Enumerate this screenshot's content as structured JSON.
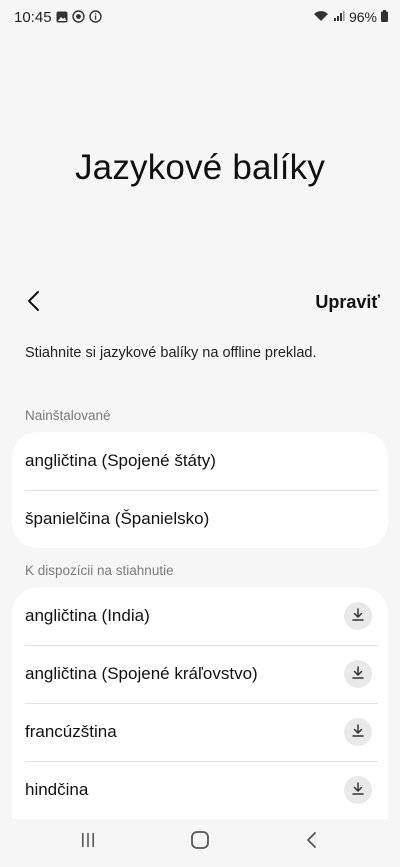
{
  "status_bar": {
    "time": "10:45",
    "battery": "96%",
    "left_icons": [
      "gallery-icon",
      "sync-icon",
      "info-icon"
    ],
    "right_icons": [
      "wifi-icon",
      "signal-icon",
      "battery-icon"
    ]
  },
  "header": {
    "title": "Jazykové balíky",
    "edit_label": "Upraviť",
    "back_icon": "back-arrow-icon"
  },
  "subtitle": "Stiahnite si jazykové balíky na offline preklad.",
  "installed": {
    "header": "Nainštalované",
    "items": [
      {
        "label": "angličtina (Spojené štáty)"
      },
      {
        "label": "španielčina (Španielsko)"
      }
    ]
  },
  "available": {
    "header": "K dispozícii na stiahnutie",
    "items": [
      {
        "label": "angličtina (India)",
        "icon": "download-icon"
      },
      {
        "label": "angličtina (Spojené kráľovstvo)",
        "icon": "download-icon"
      },
      {
        "label": "francúzština",
        "icon": "download-icon"
      },
      {
        "label": "hindčina",
        "icon": "download-icon"
      }
    ]
  },
  "nav": {
    "icons": [
      "recent-apps-icon",
      "home-icon",
      "back-icon"
    ]
  }
}
